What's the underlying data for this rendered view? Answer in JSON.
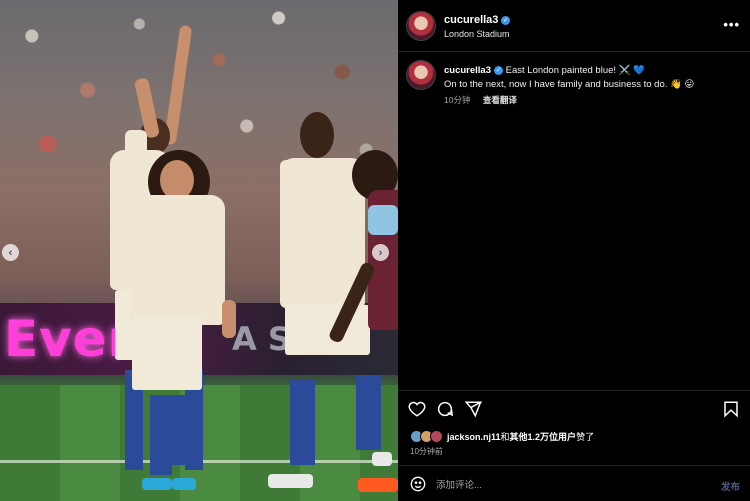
{
  "post": {
    "username": "cucurella3",
    "verified_mark": "✓",
    "location": "London Stadium",
    "more_icon": "•••"
  },
  "caption": {
    "username": "cucurella3",
    "line1": "East London painted blue! ⚔️ 💙",
    "line2": "On to the next, now I have family and business to do. 👋 😛",
    "time": "10分钟",
    "translate": "查看翻译"
  },
  "photo": {
    "board_text": "Every",
    "board_text2": "A S"
  },
  "carousel": {
    "prev": "‹",
    "next": "›"
  },
  "likes": {
    "user": "jackson.nj11",
    "connector": "和",
    "others": "其他1.2万位用户",
    "suffix": "赞了"
  },
  "time_ago": "10分钟前",
  "comment": {
    "placeholder": "添加评论...",
    "post_label": "发布"
  },
  "icons": {
    "like": "heart-icon",
    "comment": "comment-icon",
    "share": "share-icon",
    "save": "bookmark-icon",
    "emoji": "emoji-icon"
  },
  "colors": {
    "accent": "#3897f0",
    "post_button": "#4a5d83",
    "background": "#000000"
  }
}
